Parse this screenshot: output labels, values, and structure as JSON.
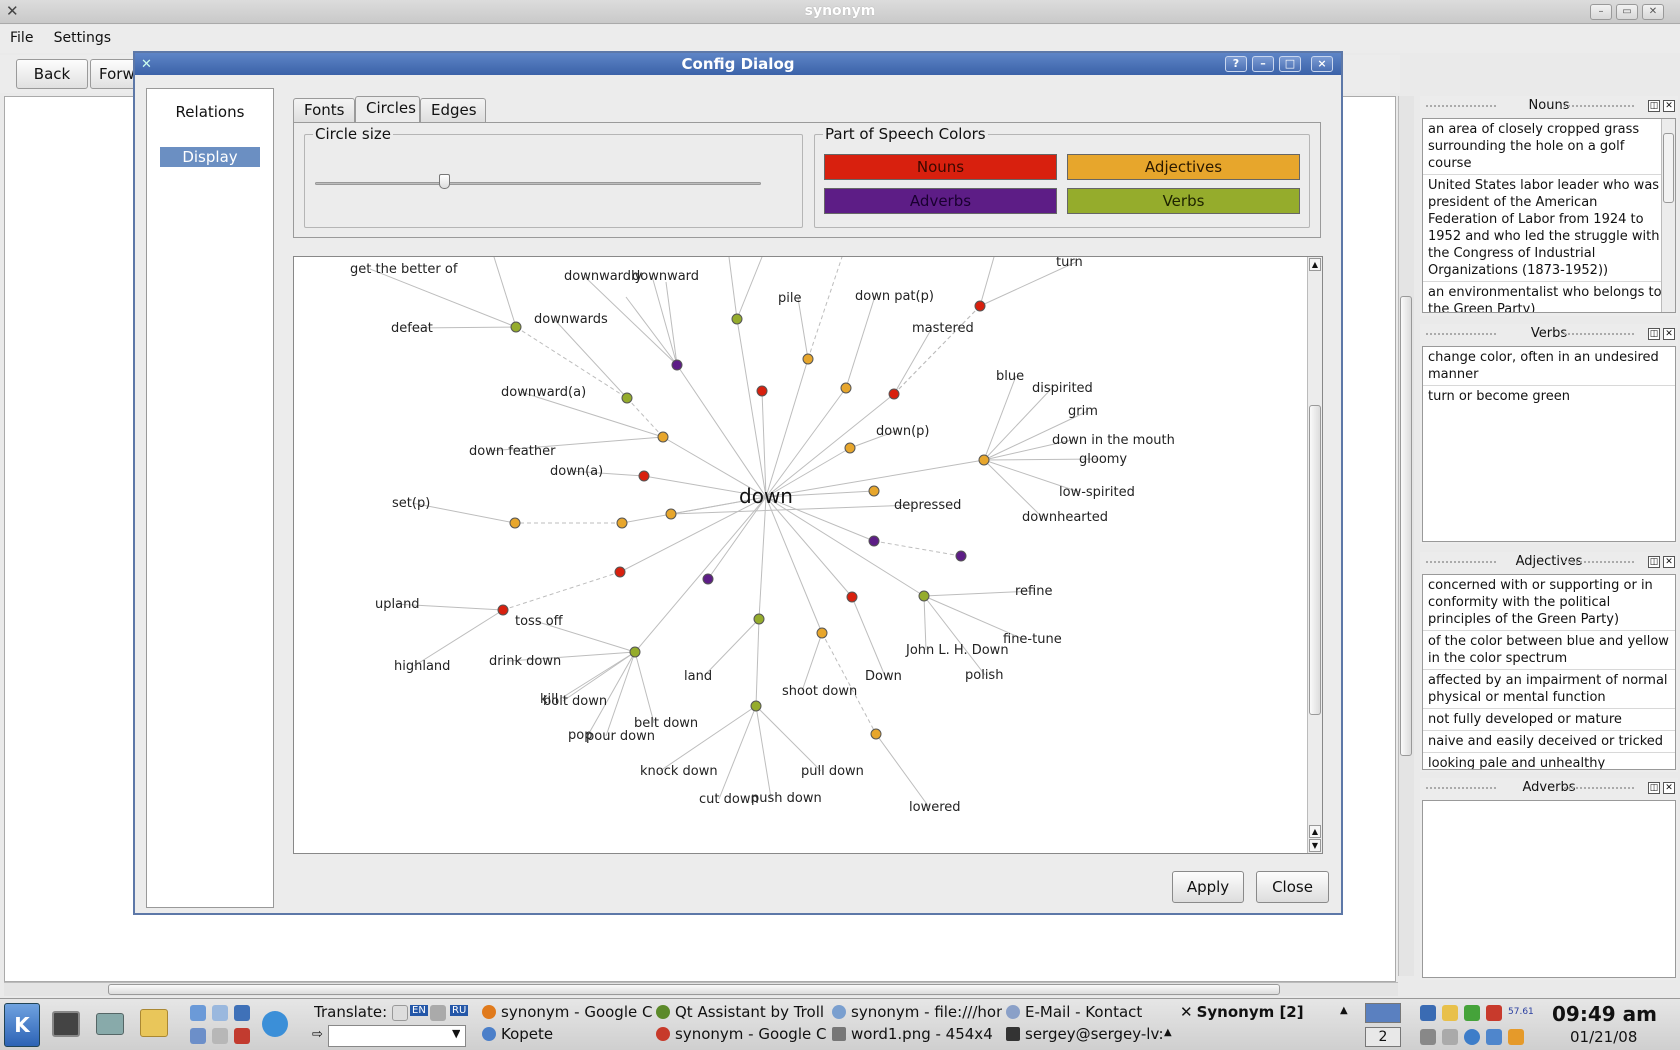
{
  "main_window": {
    "title": "synonym",
    "menu": [
      "File",
      "Settings"
    ],
    "toolbar": {
      "back": "Back",
      "forward": "Forw"
    }
  },
  "dialog": {
    "title": "Config Dialog",
    "buttons": {
      "help": "?",
      "minimize": "–",
      "maximize": "□",
      "close": "×"
    },
    "nav": {
      "relations": "Relations",
      "display": "Display"
    },
    "tabs": [
      "Fonts",
      "Circles",
      "Edges"
    ],
    "active_tab": "Circles",
    "circle_size": {
      "label": "Circle size",
      "value_fraction": 0.29
    },
    "pos_colors": {
      "label": "Part of Speech Colors",
      "nouns": {
        "label": "Nouns",
        "color": "#d8200e"
      },
      "adjectives": {
        "label": "Adjectives",
        "color": "#e7a62c"
      },
      "adverbs": {
        "label": "Adverbs",
        "color": "#5d1d86"
      },
      "verbs": {
        "label": "Verbs",
        "color": "#95ac2c"
      }
    },
    "apply": "Apply",
    "close": "Close"
  },
  "graph": {
    "center": "down",
    "labels": [
      "get the better of",
      "downwardly",
      "downward",
      "turn",
      "pile",
      "down pat(p)",
      "defeat",
      "downwards",
      "mastered",
      "blue",
      "dispirited",
      "downward(a)",
      "grim",
      "down in the mouth",
      "down feather",
      "down(p)",
      "gloomy",
      "down(a)",
      "low-spirited",
      "set(p)",
      "depressed",
      "downhearted",
      "refine",
      "upland",
      "toss off",
      "fine-tune",
      "John L. H. Down",
      "highland",
      "drink down",
      "land",
      "Down",
      "polish",
      "kill",
      "bolt down",
      "shoot down",
      "pop",
      "pour down",
      "belt down",
      "knock down",
      "pull down",
      "cut down",
      "push down",
      "lowered"
    ]
  },
  "docks": {
    "nouns": {
      "title": "Nouns",
      "items": [
        "an area of closely cropped grass surrounding the hole on a golf course",
        "United States labor leader who was president of the American Federation of Labor from 1924 to 1952 and who led the struggle with the Congress of Industrial Organizations (1873-1952))",
        "an environmentalist who belongs to the Green Party)"
      ]
    },
    "verbs": {
      "title": "Verbs",
      "items": [
        "change color, often in an undesired manner",
        "turn or become green"
      ]
    },
    "adjectives": {
      "title": "Adjectives",
      "items": [
        "concerned with or supporting or in conformity with the political principles of the Green Party)",
        "of the color between blue and yellow in the color spectrum",
        "affected by an impairment of normal physical or mental function",
        "not fully developed or mature",
        "naive and easily deceived or tricked",
        "looking pale and unhealthy"
      ]
    },
    "adverbs": {
      "title": "Adverbs",
      "items": []
    }
  },
  "taskbar": {
    "translate_label": "Translate:",
    "lang_en": "EN",
    "lang_ru": "RU",
    "tasks_row1": [
      "synonym - Google C",
      "Qt Assistant by Troll",
      "synonym - file:///hon",
      "E-Mail - Kontact",
      "Synonym [2]"
    ],
    "tasks_row2": [
      "Kopete",
      "synonym - Google C",
      "word1.png - 454x4",
      "sergey@sergey-lv:"
    ],
    "desktop_number": "2",
    "tray_text": "57.61",
    "time": "09:49 am",
    "date": "01/21/08"
  }
}
